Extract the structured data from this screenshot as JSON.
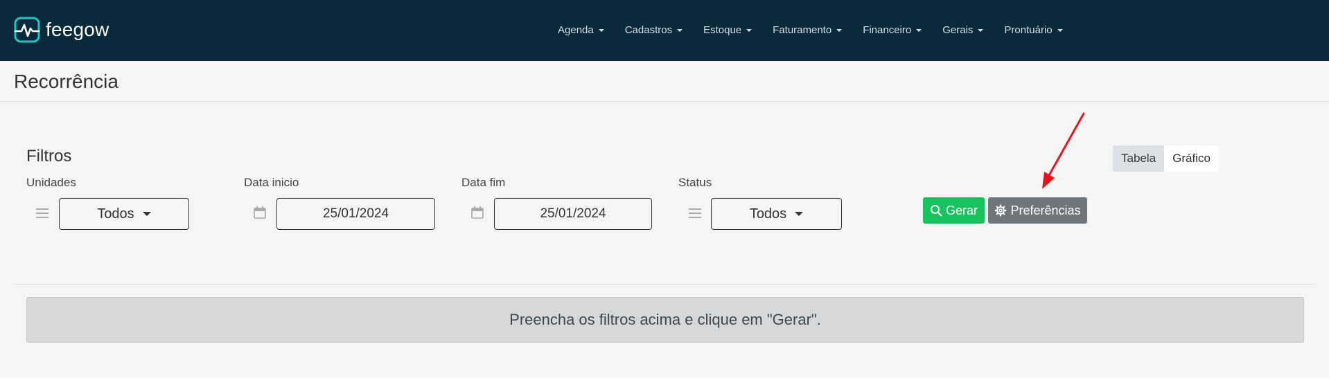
{
  "brand": {
    "name": "feegow"
  },
  "nav": {
    "items": [
      {
        "label": "Agenda"
      },
      {
        "label": "Cadastros"
      },
      {
        "label": "Estoque"
      },
      {
        "label": "Faturamento"
      },
      {
        "label": "Financeiro"
      },
      {
        "label": "Gerais"
      },
      {
        "label": "Prontuário"
      }
    ]
  },
  "page": {
    "title": "Recorrência"
  },
  "filters": {
    "title": "Filtros",
    "unidades": {
      "label": "Unidades",
      "value": "Todos"
    },
    "data_inicio": {
      "label": "Data inicio",
      "value": "25/01/2024"
    },
    "data_fim": {
      "label": "Data fim",
      "value": "25/01/2024"
    },
    "status": {
      "label": "Status",
      "value": "Todos"
    }
  },
  "actions": {
    "gerar_label": "Gerar",
    "preferencias_label": "Preferências"
  },
  "view_toggle": {
    "tabela_label": "Tabela",
    "grafico_label": "Gráfico",
    "active": "Tabela"
  },
  "alert": {
    "message": "Preencha os filtros acima e clique em \"Gerar\"."
  },
  "colors": {
    "navbar": "#082a3a",
    "logo_accent": "#23c7c1",
    "gerar": "#16c35e",
    "preferencias": "#6f767d",
    "annotation_arrow": "#e8141b"
  }
}
